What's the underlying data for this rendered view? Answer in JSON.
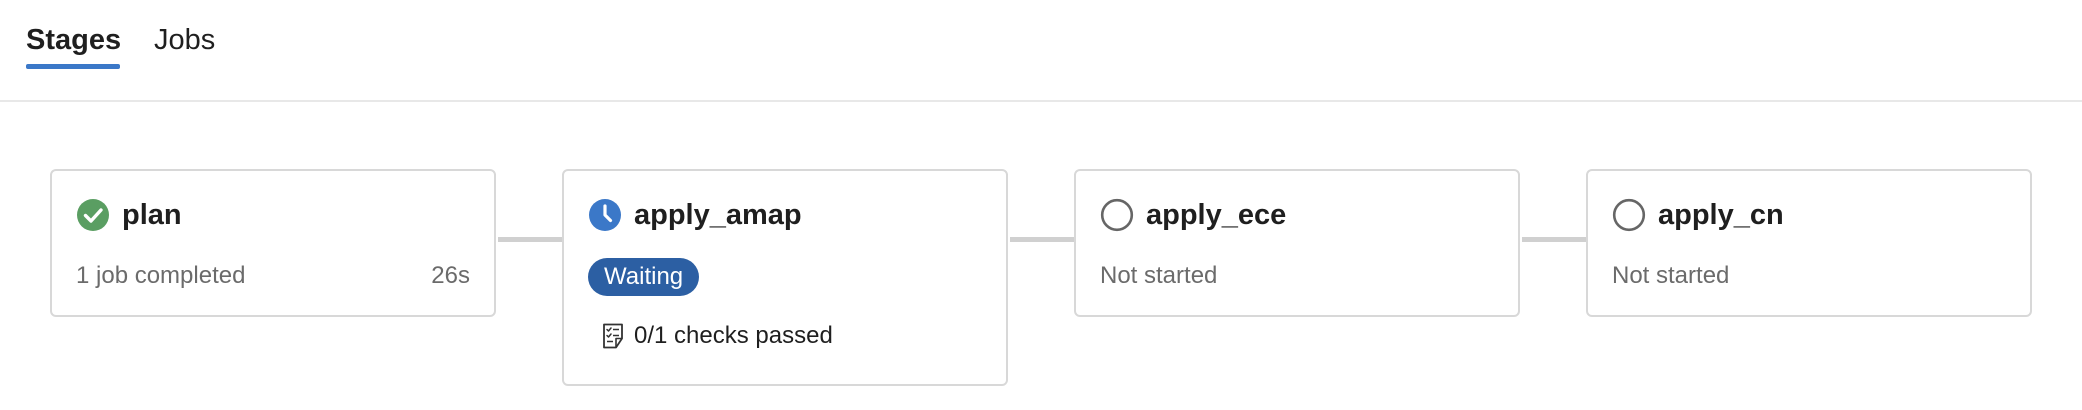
{
  "tabs": [
    {
      "label": "Stages",
      "active": true
    },
    {
      "label": "Jobs",
      "active": false
    }
  ],
  "stages": [
    {
      "name": "plan",
      "status_icon": "success-check-icon",
      "status_color": "#5a9e62",
      "summary": "1 job completed",
      "duration": "26s"
    },
    {
      "name": "apply_amap",
      "status_icon": "clock-waiting-icon",
      "status_color": "#3b78c8",
      "badge": "Waiting",
      "badge_color": "#2c5fa3",
      "checks": "0/1 checks passed",
      "checks_icon": "checklist-icon"
    },
    {
      "name": "apply_ece",
      "status_icon": "not-started-circle-icon",
      "summary": "Not started"
    },
    {
      "name": "apply_cn",
      "status_icon": "not-started-circle-icon",
      "summary": "Not started"
    }
  ],
  "colors": {
    "accent": "#3b78c8",
    "success": "#5a9e62",
    "connector": "#d0d0d0",
    "card_border": "#d8d8d8"
  }
}
